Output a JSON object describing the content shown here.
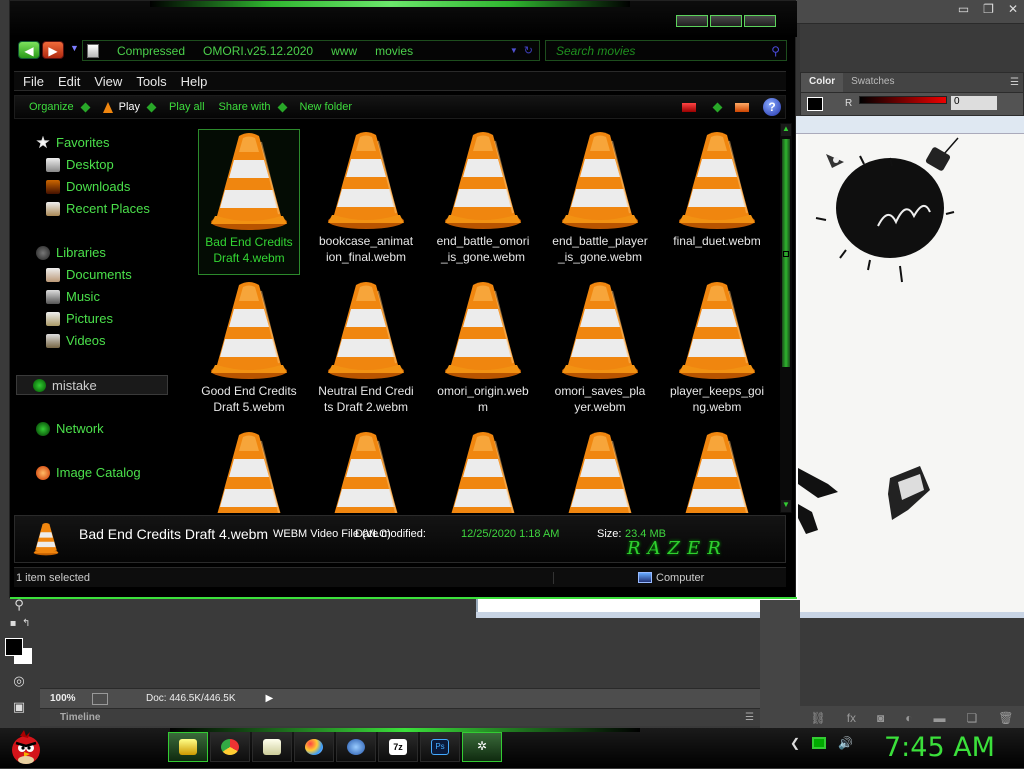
{
  "explorer": {
    "address": {
      "crumbs": [
        "Compressed",
        "OMORI.v25.12.2020",
        "www",
        "movies"
      ]
    },
    "search": {
      "placeholder": "Search movies"
    },
    "menu": [
      "File",
      "Edit",
      "View",
      "Tools",
      "Help"
    ],
    "commands": {
      "organize": "Organize",
      "play": "Play",
      "play_all": "Play all",
      "share_with": "Share with",
      "new_folder": "New folder"
    },
    "nav": {
      "favorites": "Favorites",
      "desktop": "Desktop",
      "downloads": "Downloads",
      "recent_places": "Recent Places",
      "libraries": "Libraries",
      "documents": "Documents",
      "music": "Music",
      "pictures": "Pictures",
      "videos": "Videos",
      "mistake": "mistake",
      "network": "Network",
      "image_catalog": "Image Catalog"
    },
    "files": [
      "Bad End Credits Draft 4.webm",
      "bookcase_animation_final.webm",
      "end_battle_omori_is_gone.webm",
      "end_battle_player_is_gone.webm",
      "final_duet.webm",
      "Good End Credits Draft 5.webm",
      "Neutral End Credits Draft 2.webm",
      "omori_origin.webm",
      "omori_saves_player.webm",
      "player_keeps_going.webm",
      "",
      "",
      "",
      "",
      ""
    ],
    "details": {
      "name": "Bad End Credits Draft 4.webm",
      "type": "WEBM Video File (VLC)",
      "date_label": "Date modified:",
      "date_value": "12/25/2020 1:18 AM",
      "size_label": "Size:",
      "size_value": "23.4 MB",
      "brand": "RAZER"
    },
    "status": {
      "selected": "1 item selected",
      "location": "Computer"
    }
  },
  "photoshop": {
    "panel_tabs": [
      "Color",
      "Swatches"
    ],
    "channel_label": "R",
    "channel_value": "0",
    "zoom": "100%",
    "doc": "Doc: 446.5K/446.5K",
    "timeline": "Timeline"
  },
  "taskbar": {
    "clock": "7:45 AM"
  },
  "colors": {
    "accent_green": "#3be03b",
    "vlc_orange": "#f0860f"
  }
}
